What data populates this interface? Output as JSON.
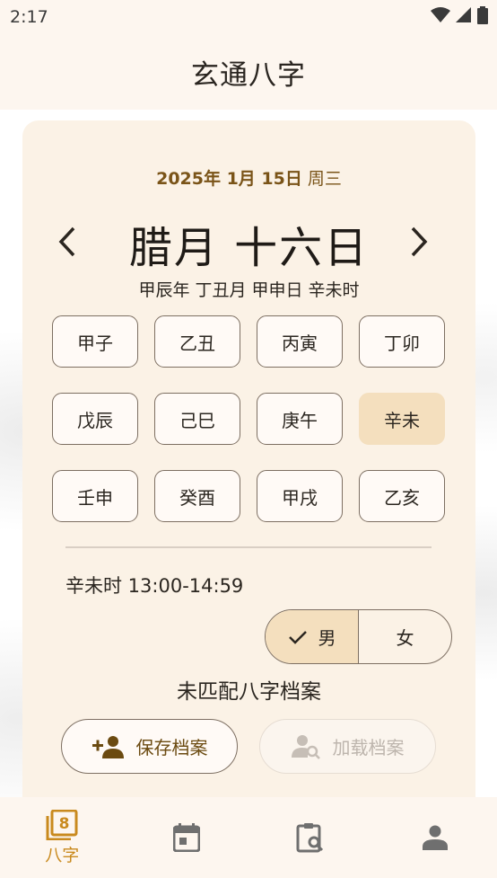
{
  "status_bar": {
    "time": "2:17",
    "icons": [
      "wifi-icon",
      "signal-icon",
      "battery-icon"
    ]
  },
  "app_bar": {
    "title": "玄通八字"
  },
  "card": {
    "solar_date": "2025年 1月 15日",
    "weekday": "周三",
    "lunar_date": "腊月 十六日",
    "ganzhi": "甲辰年 丁丑月 甲申日 辛未时",
    "prev_icon": "chevron-left-icon",
    "next_icon": "chevron-right-icon",
    "hours": [
      {
        "label": "甲子",
        "selected": false
      },
      {
        "label": "乙丑",
        "selected": false
      },
      {
        "label": "丙寅",
        "selected": false
      },
      {
        "label": "丁卯",
        "selected": false
      },
      {
        "label": "戊辰",
        "selected": false
      },
      {
        "label": "己巳",
        "selected": false
      },
      {
        "label": "庚午",
        "selected": false
      },
      {
        "label": "辛未",
        "selected": true
      },
      {
        "label": "壬申",
        "selected": false
      },
      {
        "label": "癸酉",
        "selected": false
      },
      {
        "label": "甲戌",
        "selected": false
      },
      {
        "label": "乙亥",
        "selected": false
      }
    ],
    "hour_range": "辛未时 13:00-14:59",
    "gender": {
      "male": "男",
      "female": "女",
      "selected": "male"
    },
    "match_status": "未匹配八字档案",
    "save_button": "保存档案",
    "load_button": "加载档案"
  },
  "bottom_nav": {
    "items": [
      {
        "icon": "bazi-book-icon",
        "label": "八字",
        "active": true
      },
      {
        "icon": "calendar-icon",
        "label": "",
        "active": false
      },
      {
        "icon": "clipboard-search-icon",
        "label": "",
        "active": false
      },
      {
        "icon": "person-icon",
        "label": "",
        "active": false
      }
    ]
  },
  "colors": {
    "accent": "#c98a1e",
    "selected_bg": "#f4dfbe",
    "card_bg": "#fbf2e6",
    "date_brown": "#7a5418"
  }
}
